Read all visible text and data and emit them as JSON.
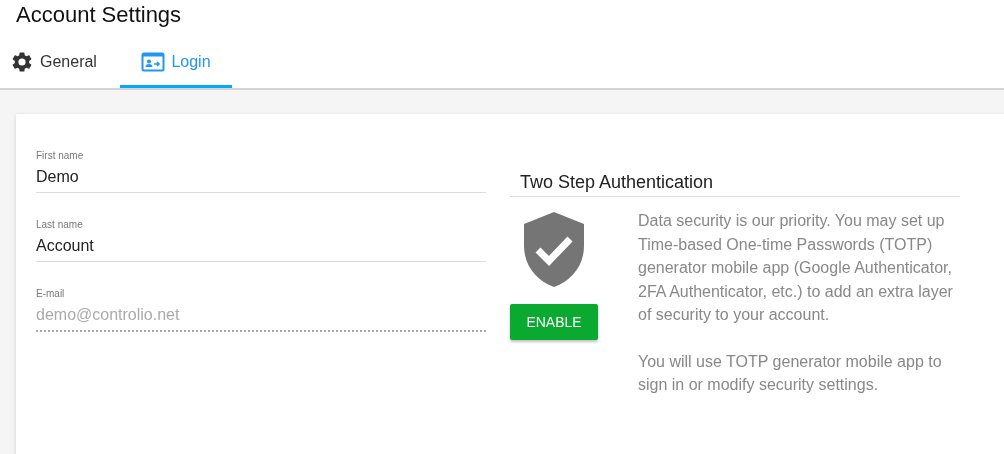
{
  "page": {
    "title": "Account Settings"
  },
  "tabs": [
    {
      "label": "General",
      "selected": false
    },
    {
      "label": "Login",
      "selected": true
    }
  ],
  "fields": [
    {
      "label": "First name",
      "value": "Demo",
      "disabled": false
    },
    {
      "label": "Last name",
      "value": "Account",
      "disabled": false
    },
    {
      "label": "E-mail",
      "value": "demo@controlio.net",
      "disabled": true
    }
  ],
  "two_step": {
    "title": "Two Step Authentication",
    "button": "ENABLE",
    "paragraphs": [
      "Data security is our priority. You may set up Time-based One-time Passwords (TOTP) generator mobile app (Google Authenticator, 2FA Authenticator, etc.) to add an extra layer of security to your account.",
      "You will use TOTP generator mobile app to sign in or modify security settings."
    ]
  }
}
